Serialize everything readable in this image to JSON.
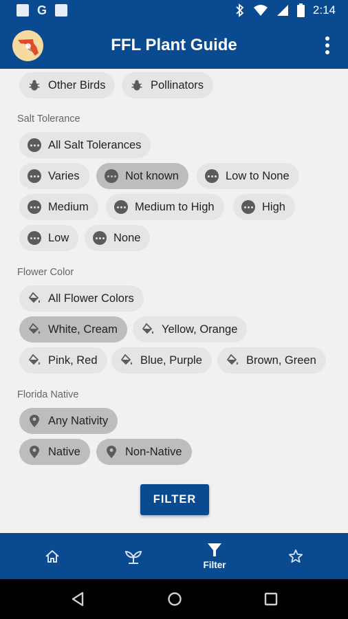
{
  "status_bar": {
    "time": "2:14",
    "g_label": "G"
  },
  "app_bar": {
    "title": "FFL Plant Guide",
    "logo_icon": "florida-logo-icon",
    "menu_icon": "more-vert-icon"
  },
  "sections": {
    "wildlife_partial": {
      "chips": [
        {
          "label": "Other Birds",
          "icon": "bug-icon",
          "selected": false
        },
        {
          "label": "Pollinators",
          "icon": "bug-icon",
          "selected": false
        }
      ]
    },
    "salt_tolerance": {
      "label": "Salt Tolerance",
      "chips": [
        {
          "label": "All Salt Tolerances",
          "selected": false
        },
        {
          "label": "Varies",
          "selected": false
        },
        {
          "label": "Not known",
          "selected": true
        },
        {
          "label": "Low to None",
          "selected": false
        },
        {
          "label": "Medium",
          "selected": false
        },
        {
          "label": "Medium to High",
          "selected": false
        },
        {
          "label": "High",
          "selected": false
        },
        {
          "label": "Low",
          "selected": false
        },
        {
          "label": "None",
          "selected": false
        }
      ]
    },
    "flower_color": {
      "label": "Flower Color",
      "chips": [
        {
          "label": "All Flower Colors",
          "selected": false
        },
        {
          "label": "White, Cream",
          "selected": true
        },
        {
          "label": "Yellow, Orange",
          "selected": false
        },
        {
          "label": "Pink, Red",
          "selected": false
        },
        {
          "label": "Blue, Purple",
          "selected": false
        },
        {
          "label": "Brown, Green",
          "selected": false
        }
      ]
    },
    "florida_native": {
      "label": "Florida Native",
      "chips": [
        {
          "label": "Any Nativity",
          "selected": true
        },
        {
          "label": "Native",
          "selected": true
        },
        {
          "label": "Non-Native",
          "selected": true
        }
      ]
    }
  },
  "filter_button": {
    "label": "FILTER"
  },
  "bottom_nav": {
    "items": [
      {
        "name": "home",
        "icon": "home-icon",
        "label": ""
      },
      {
        "name": "plants",
        "icon": "sprout-icon",
        "label": ""
      },
      {
        "name": "filter",
        "icon": "filter-icon",
        "label": "Filter",
        "active": true
      },
      {
        "name": "favorites",
        "icon": "star-icon",
        "label": ""
      }
    ]
  },
  "colors": {
    "primary": "#0a4a90",
    "chip": "#e5e5e5",
    "chip_selected": "#bdbdbd",
    "background": "#f1f1f1"
  }
}
